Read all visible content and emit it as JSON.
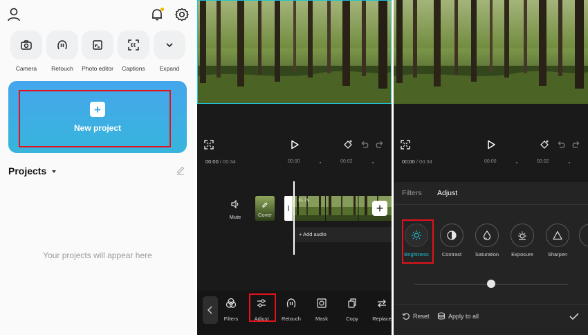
{
  "home": {
    "quick_actions": [
      {
        "label": "Camera",
        "icon": "camera-icon"
      },
      {
        "label": "Retouch",
        "icon": "retouch-icon"
      },
      {
        "label": "Photo editor",
        "icon": "photo-editor-icon"
      },
      {
        "label": "Captions",
        "icon": "captions-icon"
      },
      {
        "label": "Expand",
        "icon": "chevron-down-icon"
      }
    ],
    "new_project_label": "New project",
    "projects_title": "Projects",
    "empty_message": "Your projects will appear here",
    "notification_dot_color": "#f5b800"
  },
  "editor": {
    "time_current": "00:00",
    "time_total": "/ 00:34",
    "ticks": [
      "00:00",
      "00:02"
    ],
    "mute_label": "Mute",
    "cover_label": "Cover",
    "clip_duration": "31.7s",
    "add_audio_label": "+ Add audio",
    "toolbar": [
      {
        "label": "Filters",
        "icon": "filters-icon"
      },
      {
        "label": "Adjust",
        "icon": "adjust-icon"
      },
      {
        "label": "Retouch",
        "icon": "retouch-icon"
      },
      {
        "label": "Mask",
        "icon": "mask-icon"
      },
      {
        "label": "Copy",
        "icon": "copy-icon"
      },
      {
        "label": "Replace",
        "icon": "replace-icon"
      }
    ]
  },
  "adjust": {
    "time_current": "00:00",
    "time_total": "/ 00:34",
    "ticks": [
      "00:00",
      "00:02"
    ],
    "tabs": [
      "Filters",
      "Adjust"
    ],
    "active_tab": "Adjust",
    "items": [
      {
        "label": "Brightness",
        "icon": "brightness-icon",
        "active": true
      },
      {
        "label": "Contrast",
        "icon": "contrast-icon"
      },
      {
        "label": "Saturation",
        "icon": "saturation-icon"
      },
      {
        "label": "Exposure",
        "icon": "exposure-icon"
      },
      {
        "label": "Sharpen",
        "icon": "sharpen-icon"
      }
    ],
    "slider_value": 0.5,
    "reset_label": "Reset",
    "apply_all_label": "Apply to all"
  },
  "colors": {
    "accent_teal": "#1fc3d6",
    "highlight_red": "#e3121b",
    "new_project_gradient_start": "#45a6ec",
    "new_project_gradient_end": "#37b5dc",
    "dark_bg": "#1a1a1a"
  }
}
